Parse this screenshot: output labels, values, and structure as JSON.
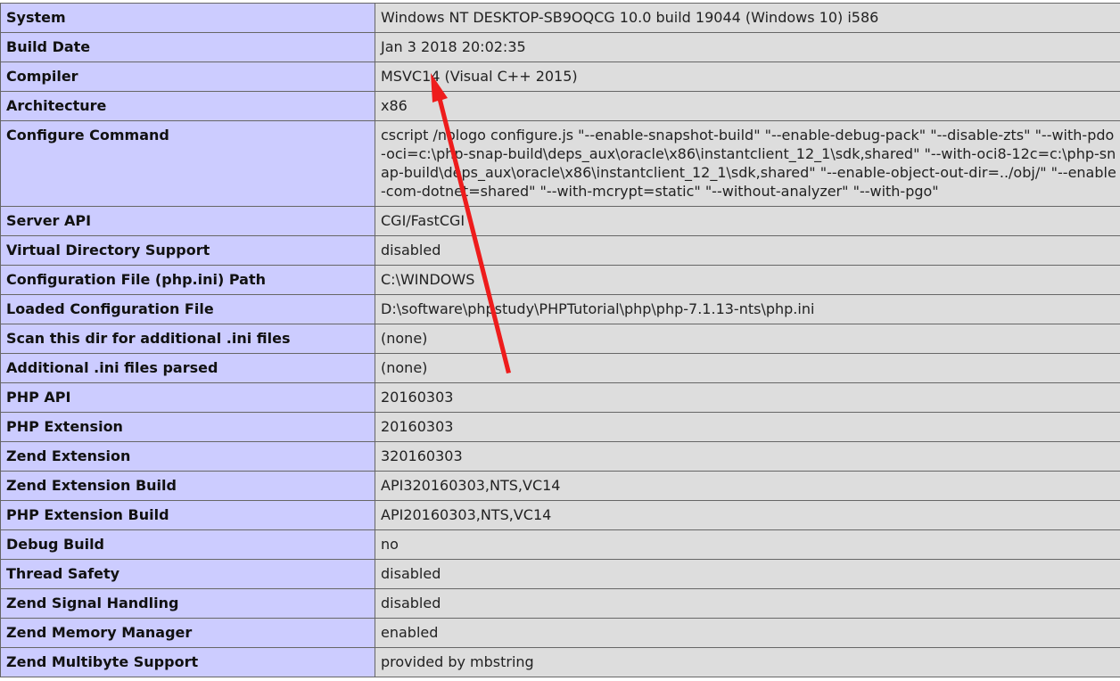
{
  "rows": [
    {
      "key": "System",
      "value": "Windows NT DESKTOP-SB9OQCG 10.0 build 19044 (Windows 10) i586"
    },
    {
      "key": "Build Date",
      "value": "Jan 3 2018 20:02:35"
    },
    {
      "key": "Compiler",
      "value": "MSVC14 (Visual C++ 2015)"
    },
    {
      "key": "Architecture",
      "value": "x86"
    },
    {
      "key": "Configure Command",
      "value": "cscript /nologo configure.js \"--enable-snapshot-build\" \"--enable-debug-pack\" \"--disable-zts\" \"--with-pdo-oci=c:\\php-snap-build\\deps_aux\\oracle\\x86\\instantclient_12_1\\sdk,shared\" \"--with-oci8-12c=c:\\php-snap-build\\deps_aux\\oracle\\x86\\instantclient_12_1\\sdk,shared\" \"--enable-object-out-dir=../obj/\" \"--enable-com-dotnet=shared\" \"--with-mcrypt=static\" \"--without-analyzer\" \"--with-pgo\""
    },
    {
      "key": "Server API",
      "value": "CGI/FastCGI"
    },
    {
      "key": "Virtual Directory Support",
      "value": "disabled"
    },
    {
      "key": "Configuration File (php.ini) Path",
      "value": "C:\\WINDOWS"
    },
    {
      "key": "Loaded Configuration File",
      "value": "D:\\software\\phpstudy\\PHPTutorial\\php\\php-7.1.13-nts\\php.ini"
    },
    {
      "key": "Scan this dir for additional .ini files",
      "value": "(none)"
    },
    {
      "key": "Additional .ini files parsed",
      "value": "(none)"
    },
    {
      "key": "PHP API",
      "value": "20160303"
    },
    {
      "key": "PHP Extension",
      "value": "20160303"
    },
    {
      "key": "Zend Extension",
      "value": "320160303"
    },
    {
      "key": "Zend Extension Build",
      "value": "API320160303,NTS,VC14"
    },
    {
      "key": "PHP Extension Build",
      "value": "API20160303,NTS,VC14"
    },
    {
      "key": "Debug Build",
      "value": "no"
    },
    {
      "key": "Thread Safety",
      "value": "disabled"
    },
    {
      "key": "Zend Signal Handling",
      "value": "disabled"
    },
    {
      "key": "Zend Memory Manager",
      "value": "enabled"
    },
    {
      "key": "Zend Multibyte Support",
      "value": "provided by mbstring"
    }
  ],
  "colors": {
    "key_bg": "#ccccff",
    "value_bg": "#dddddd",
    "border": "#666666",
    "arrow": "#ee1c1c"
  },
  "annotation": {
    "icon": "red-arrow-icon"
  }
}
